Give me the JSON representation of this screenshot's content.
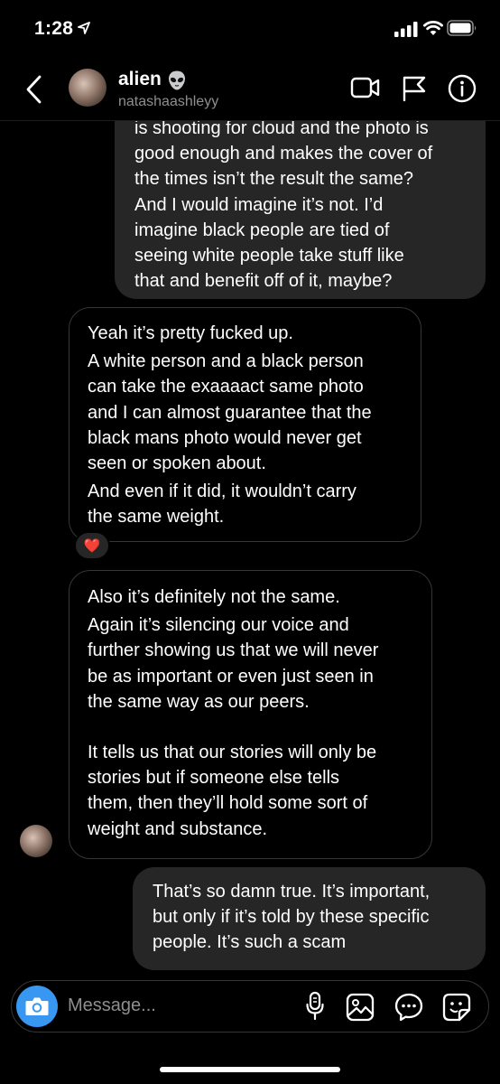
{
  "status_bar": {
    "time": "1:28"
  },
  "header": {
    "name": "alien",
    "username": "natashaashleyy"
  },
  "messages": [
    {
      "sender": "me",
      "lines": [
        "is shooting for cloud and the photo is",
        "good enough and makes the cover of",
        "the times isn’t the result the same?",
        "And I would imagine it’s not. I’d",
        "imagine black people are tied of",
        "seeing white people take stuff like",
        "that and benefit off of it, maybe?"
      ]
    },
    {
      "sender": "them",
      "lines": [
        "Yeah it’s pretty fucked up.",
        "A white person and a black person",
        "can take the exaaaact same photo",
        "and I can almost guarantee that the",
        "black mans photo would never get",
        "seen or spoken about.",
        "And even if it did, it wouldn’t carry",
        "the same weight."
      ],
      "reaction": "❤️"
    },
    {
      "sender": "them",
      "lines": [
        "Also it’s definitely not the same.",
        "Again it’s silencing our voice and",
        "further showing us that we will never",
        "be as important or even just seen in",
        "the same way as our peers.",
        "It tells us that our stories will only be",
        "stories but if someone else tells",
        "them, then they’ll hold some sort of",
        "weight and substance."
      ]
    },
    {
      "sender": "me",
      "lines": [
        "That’s so damn true. It’s important,",
        "but only if it’s told by these specific",
        "people. It’s such a scam"
      ]
    }
  ],
  "composer": {
    "placeholder": "Message..."
  },
  "icons": {
    "header": [
      "back-chevron-icon",
      "video-call-icon",
      "flag-icon",
      "info-icon"
    ],
    "composer": [
      "camera-icon",
      "microphone-icon",
      "gallery-icon",
      "chat-gif-icon",
      "sticker-icon"
    ]
  },
  "colors": {
    "background": "#000000",
    "outgoing_bubble": "#262626",
    "incoming_border": "#363636",
    "camera_button": "#3897f0",
    "secondary_text": "#8e8e8e"
  }
}
